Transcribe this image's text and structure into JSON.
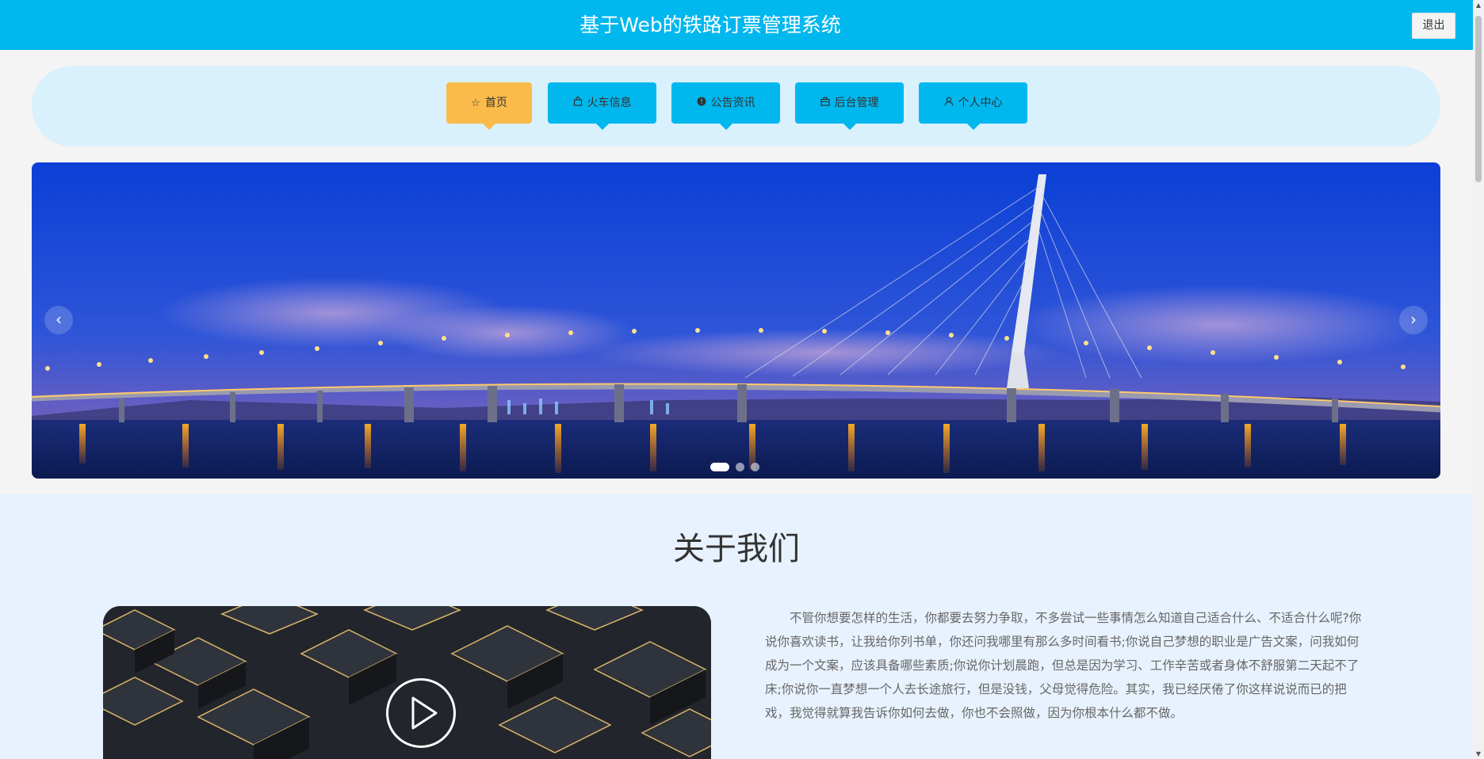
{
  "header": {
    "title": "基于Web的铁路订票管理系统",
    "logout_label": "退出"
  },
  "nav": {
    "items": [
      {
        "label": "首页",
        "icon": "star-icon",
        "active": true
      },
      {
        "label": "火车信息",
        "icon": "bag-icon"
      },
      {
        "label": "公告资讯",
        "icon": "info-circle-icon"
      },
      {
        "label": "后台管理",
        "icon": "briefcase-icon"
      },
      {
        "label": "个人中心",
        "icon": "user-icon"
      }
    ]
  },
  "banner": {
    "slide_count": 3,
    "active_slide": 1
  },
  "about": {
    "title": "关于我们",
    "text": "不管你想要怎样的生活，你都要去努力争取，不多尝试一些事情怎么知道自己适合什么、不适合什么呢?你说你喜欢读书，让我给你列书单，你还问我哪里有那么多时间看书;你说自己梦想的职业是广告文案，问我如何成为一个文案，应该具备哪些素质;你说你计划晨跑，但总是因为学习、工作辛苦或者身体不舒服第二天起不了床;你说你一直梦想一个人去长途旅行，但是没钱，父母觉得危险。其实，我已经厌倦了你这样说说而已的把戏，我觉得就算我告诉你如何去做，你也不会照做，因为你根本什么都不做。"
  },
  "colors": {
    "header": "#00b7ee",
    "nav_active": "#fbbb4b",
    "nav_bg": "#d9f1fd",
    "about_bg": "#e8f2fe"
  }
}
